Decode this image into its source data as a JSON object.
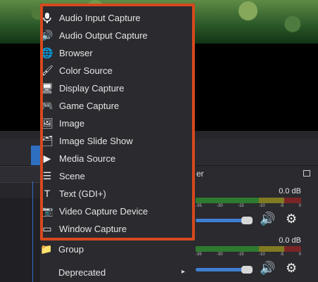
{
  "add_source_menu": {
    "items": [
      {
        "label": "Audio Input Capture",
        "icon": "microphone-icon"
      },
      {
        "label": "Audio Output Capture",
        "icon": "speaker-icon"
      },
      {
        "label": "Browser",
        "icon": "globe-icon"
      },
      {
        "label": "Color Source",
        "icon": "brush-icon"
      },
      {
        "label": "Display Capture",
        "icon": "monitor-icon"
      },
      {
        "label": "Game Capture",
        "icon": "gamepad-icon"
      },
      {
        "label": "Image",
        "icon": "image-icon"
      },
      {
        "label": "Image Slide Show",
        "icon": "slideshow-icon"
      },
      {
        "label": "Media Source",
        "icon": "play-icon"
      },
      {
        "label": "Scene",
        "icon": "list-icon"
      },
      {
        "label": "Text (GDI+)",
        "icon": "text-icon"
      },
      {
        "label": "Video Capture Device",
        "icon": "camera-icon"
      },
      {
        "label": "Window Capture",
        "icon": "window-icon"
      }
    ],
    "extra": [
      {
        "label": "Group",
        "icon": "folder-icon"
      },
      {
        "label": "Deprecated",
        "icon": "chevron-right-icon"
      }
    ]
  },
  "mixer": {
    "title_fragment": "er",
    "channels": [
      {
        "db": "0.0 dB",
        "ticks": [
          "-35",
          "-30",
          "-15",
          "-10",
          "-5",
          "0"
        ]
      },
      {
        "db": "0.0 dB",
        "ticks": [
          "-35",
          "-30",
          "-15",
          "-10",
          "-5",
          "0"
        ]
      }
    ]
  },
  "colors": {
    "highlight": "#d6491e",
    "accent": "#2f6fc1",
    "menu_bg": "#2a2a2f"
  }
}
